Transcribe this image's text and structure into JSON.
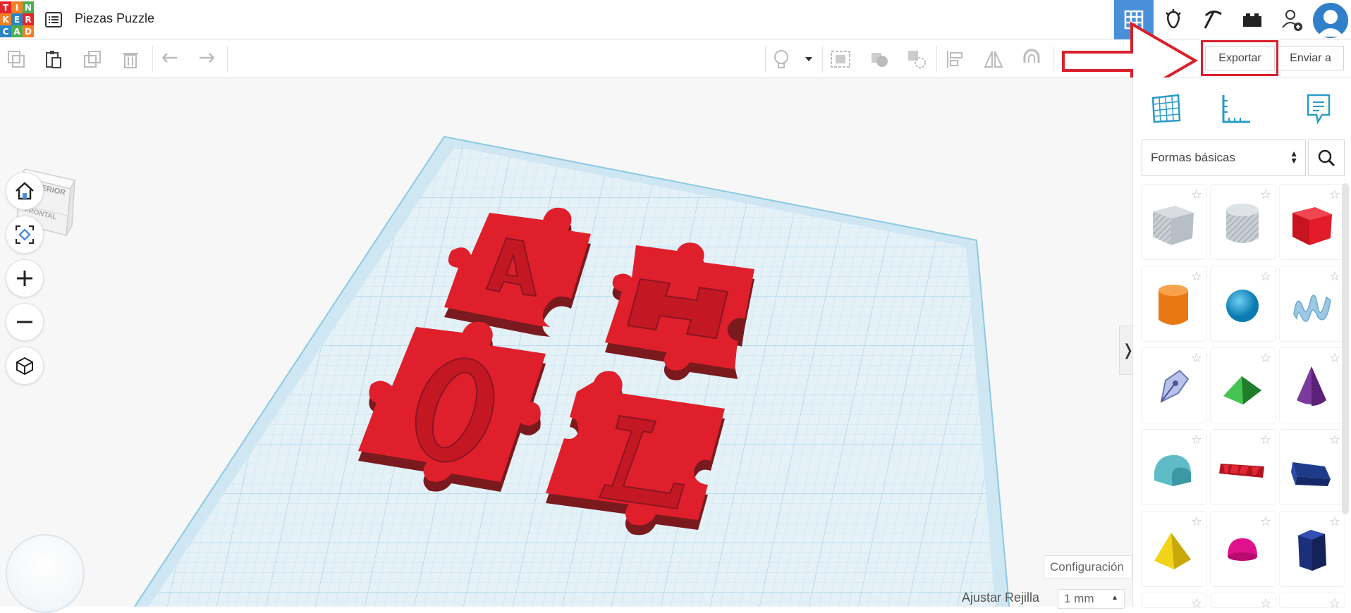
{
  "app": {
    "logo_letters": [
      "T",
      "I",
      "N",
      "K",
      "E",
      "R",
      "C",
      "A",
      "D"
    ],
    "logo_colors": [
      "#e2262d",
      "#f38123",
      "#4cae4f",
      "#f38123",
      "#2a85c6",
      "#e2262d",
      "#2a85c6",
      "#4cae4f",
      "#f38123"
    ],
    "project_title": "Piezas Puzzle"
  },
  "topbar": {
    "icons": [
      "3d-design-icon",
      "circuits-icon",
      "codeblocks-icon",
      "bricks-icon",
      "add-user-icon",
      "avatar"
    ]
  },
  "toolbar": {
    "export_label": "Exportar",
    "send_label": "Enviar a"
  },
  "viewcube": {
    "top_label": "SUPERIOR",
    "front_label": "FRONTAL"
  },
  "workplane": {
    "settings_label": "Configuración",
    "snap_label": "Ajustar Rejilla",
    "snap_value": "1 mm",
    "pieces": [
      "A",
      "H",
      "O",
      "L"
    ],
    "piece_color": "#e01f2c"
  },
  "panel": {
    "category": "Formas básicas",
    "shapes": [
      "box-striped",
      "cylinder-striped",
      "box",
      "cylinder",
      "sphere",
      "scribble",
      "pen-tool",
      "roof",
      "cone",
      "round-roof",
      "text",
      "wedge",
      "pyramid",
      "half-sphere",
      "polygon"
    ]
  },
  "colors": {
    "accent_blue": "#4a90d9",
    "highlight_red": "#d8202a"
  }
}
